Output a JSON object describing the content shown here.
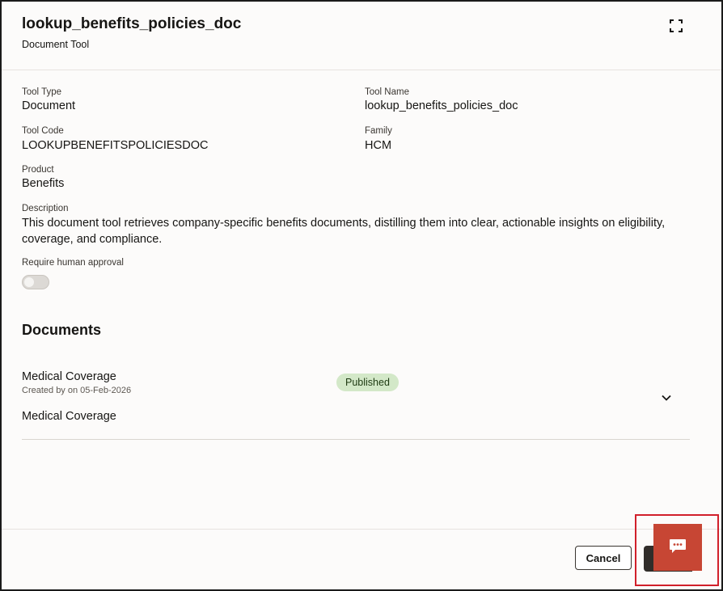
{
  "header": {
    "title": "lookup_benefits_policies_doc",
    "subtitle": "Document Tool",
    "expand_icon": "expand-icon"
  },
  "fields": {
    "tool_type": {
      "label": "Tool Type",
      "value": "Document"
    },
    "tool_name": {
      "label": "Tool Name",
      "value": "lookup_benefits_policies_doc"
    },
    "tool_code": {
      "label": "Tool Code",
      "value": "LOOKUPBENEFITSPOLICIESDOC"
    },
    "family": {
      "label": "Family",
      "value": "HCM"
    },
    "product": {
      "label": "Product",
      "value": "Benefits"
    },
    "description": {
      "label": "Description",
      "value": "This document tool retrieves company-specific benefits documents, distilling them into clear, actionable insights on eligibility, coverage, and compliance."
    },
    "human_approval": {
      "label": "Require human approval",
      "enabled": false
    }
  },
  "documents": {
    "heading": "Documents",
    "items": [
      {
        "name": "Medical Coverage",
        "meta": "Created by on 05-Feb-2026",
        "status": "Published",
        "subtitle": "Medical Coverage",
        "chevron_icon": "chevron-down-icon"
      }
    ]
  },
  "footer": {
    "cancel_label": "Cancel"
  },
  "chat": {
    "icon": "chat-bubble-icon"
  },
  "colors": {
    "badge_bg": "#d3e8c8",
    "chat_bg": "#c74634",
    "highlight": "#d1202b",
    "primary_button": "#312d2a"
  }
}
